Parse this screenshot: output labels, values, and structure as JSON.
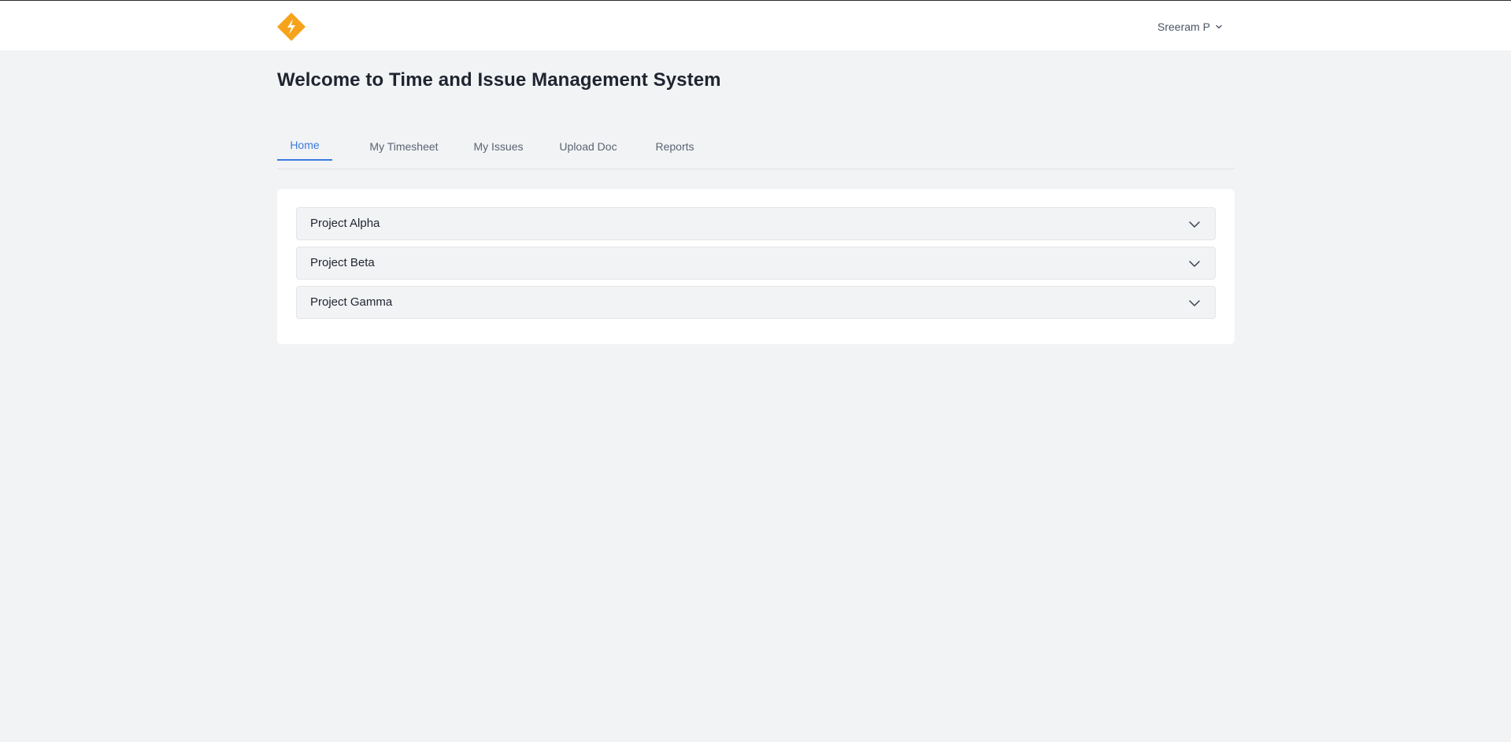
{
  "header": {
    "logo_icon": "diamond-logo-icon",
    "brand_color": "#f5a31a",
    "user_name": "Sreeram P",
    "user_menu_icon": "chevron-down-icon"
  },
  "page": {
    "title": "Welcome to Time and Issue Management System"
  },
  "tabs": [
    {
      "label": "Home",
      "active": true
    },
    {
      "label": "My Timesheet",
      "active": false
    },
    {
      "label": "My Issues",
      "active": false
    },
    {
      "label": "Upload Doc",
      "active": false
    },
    {
      "label": "Reports",
      "active": false
    }
  ],
  "projects": [
    {
      "name": "Project Alpha",
      "icon": "chevron-down-icon"
    },
    {
      "name": "Project Beta",
      "icon": "chevron-down-icon"
    },
    {
      "name": "Project Gamma",
      "icon": "chevron-down-icon"
    }
  ],
  "colors": {
    "accent": "#3b7be0",
    "background": "#f2f3f5"
  }
}
